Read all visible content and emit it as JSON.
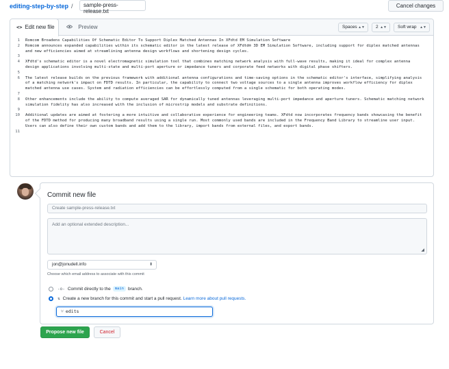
{
  "header": {
    "repo": "editing-step-by-step",
    "separator": "/",
    "filename": "sample-press-release.txt",
    "cancel_label": "Cancel changes"
  },
  "editor": {
    "tab_edit": "Edit new file",
    "tab_edit_icon": "<>",
    "tab_preview": "Preview",
    "indent_mode": "Spaces",
    "indent_size": "2",
    "wrap_mode": "Soft wrap",
    "lines": [
      {
        "n": "1",
        "text": "Romcom Broadens Capabilities Of Schematic Editor To Support Diplex Matched Antennas In XFdtd EM Simulation Software"
      },
      {
        "n": "2",
        "text": "Romcom announces expanded capabilities within its schematic editor in the latest release of XFdtd® 3D EM Simulation Software, including support for diplex matched antennas and new efficiencies aimed at streamlining antenna design workflows and shortening design cycles."
      },
      {
        "n": "3",
        "text": ""
      },
      {
        "n": "4",
        "text": "XFdtd's schematic editor is a novel electromagnetic simulation tool that combines matching network analysis with full-wave results, making it ideal for complex antenna design applications involving multi-state and multi-port aperture or impedance tuners and corporate feed networks with digital phase shifters."
      },
      {
        "n": "5",
        "text": ""
      },
      {
        "n": "6",
        "text": "The latest release builds on the previous framework with additional antenna configurations and time-saving options in the schematic editor's interface, simplifying analysis of a matching network's impact on FDTD results. In particular, the capability to connect two voltage sources to a single antenna improves workflow efficiency for diplex matched antenna use cases. System and radiation efficiencies can be effortlessly computed from a single schematic for both operating modes."
      },
      {
        "n": "7",
        "text": ""
      },
      {
        "n": "8",
        "text": "Other enhancements include the ability to compute averaged SAR for dynamically tuned antennas leveraging multi-port impedance and aperture tuners. Schematic matching network simulation fidelity has also increased with the inclusion of microstrip models and substrate definitions."
      },
      {
        "n": "9",
        "text": ""
      },
      {
        "n": "10",
        "text": "Additional updates are aimed at fostering a more intuitive and collaborative experience for engineering teams. XFdtd now incorporates frequency bands showcasing the benefit of the FDTD method for producing many broadband results using a single run. Most commonly used bands are included in the Frequency Band Library to streamline user input. Users can also define their own custom bands and add them to the library, import bands from external files, and export bands."
      },
      {
        "n": "11",
        "text": ""
      }
    ]
  },
  "commit": {
    "title": "Commit new file",
    "summary_placeholder": "Create sample-press-release.txt",
    "description_placeholder": "Add an optional extended description...",
    "email": "jon@jonudell.info",
    "email_note": "Choose which email address to associate with this commit",
    "option_direct_prefix": "Commit directly to the",
    "option_direct_branch": "main",
    "option_direct_suffix": "branch.",
    "option_new_branch": "Create a new branch for this commit and start a pull request.",
    "option_new_branch_link": "Learn more about pull requests.",
    "selected_option": "new-branch",
    "branch_name": "edits",
    "propose_label": "Propose new file",
    "cancel_label": "Cancel"
  },
  "colors": {
    "accent": "#0969da",
    "primary_button": "#2da44e",
    "danger": "#cf222e"
  }
}
